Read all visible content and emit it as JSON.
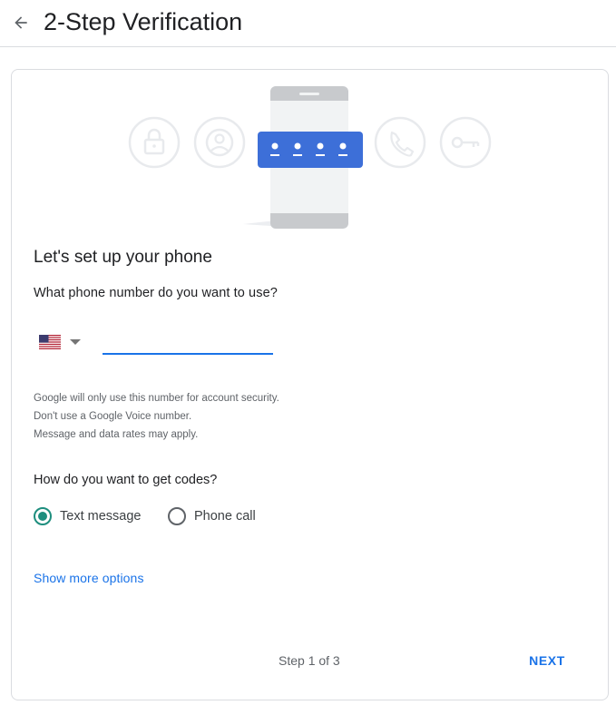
{
  "header": {
    "title": "2-Step Verification",
    "back_icon": "arrow-left-icon"
  },
  "illustration": {
    "icons": [
      "lock-icon",
      "account-circle-icon",
      "phone-icon",
      "key-icon"
    ],
    "accent_color": "#3d6fd8"
  },
  "setup": {
    "heading": "Let's set up your phone",
    "phone_question": "What phone number do you want to use?",
    "country_flag": "us-flag-icon",
    "phone_value": "",
    "helper_lines": [
      "Google will only use this number for account security.",
      "Don't use a Google Voice number.",
      "Message and data rates may apply."
    ],
    "codes_question": "How do you want to get codes?",
    "options": [
      {
        "label": "Text message",
        "checked": true
      },
      {
        "label": "Phone call",
        "checked": false
      }
    ],
    "show_more": "Show more options"
  },
  "footer": {
    "step_text": "Step 1 of 3",
    "next_label": "NEXT"
  },
  "colors": {
    "primary": "#1a73e8",
    "radio_checked": "#1e8e7e",
    "divider": "#dadce0"
  }
}
